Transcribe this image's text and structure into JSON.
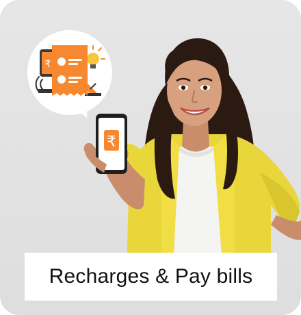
{
  "tile": {
    "label": "Recharges & Pay bills",
    "accent_color": "#f7882f",
    "icons": [
      "bill-receipt-icon",
      "rupee-icon",
      "mobile-phone-icon",
      "lightbulb-icon",
      "wifi-icon",
      "satellite-dish-icon"
    ]
  },
  "phone_screen": {
    "symbol": "₹"
  }
}
